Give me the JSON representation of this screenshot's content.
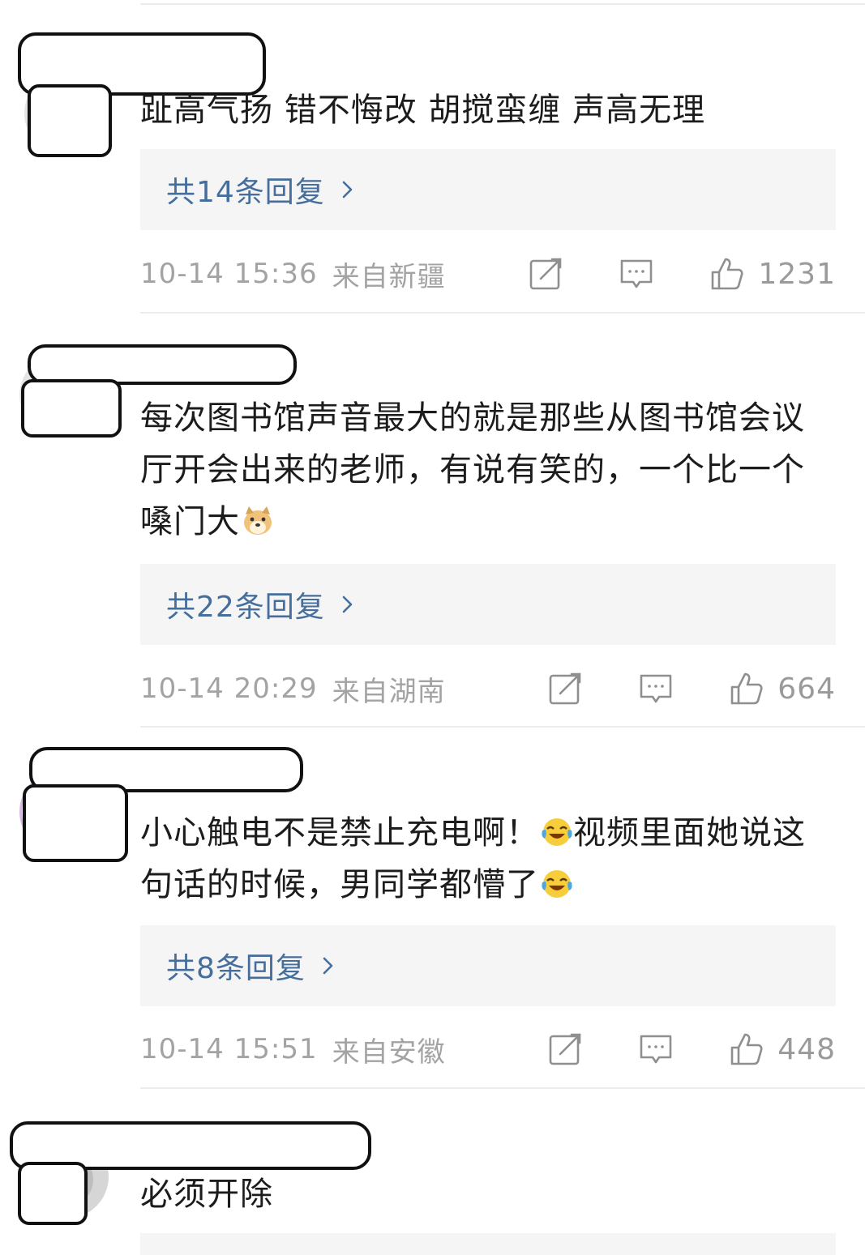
{
  "comments": [
    {
      "text": "趾高气扬 错不悔改 胡搅蛮缠 声高无理",
      "replies_label": "共14条回复",
      "timestamp": "10-14 15:36",
      "location": "来自新疆",
      "likes": "1231"
    },
    {
      "text": "每次图书馆声音最大的就是那些从图书馆会议厅开会出来的老师，有说有笑的，一个比一个嗓门大",
      "emoji_after": "doge-emoji",
      "replies_label": "共22条回复",
      "timestamp": "10-14 20:29",
      "location": "来自湖南",
      "likes": "664"
    },
    {
      "text_part1": "小心触电不是禁止充电啊！",
      "emoji_mid": "laugh-cry-emoji",
      "text_part2": "视频里面她说这句话的时候，男同学都懵了",
      "emoji_after": "laugh-cry-emoji",
      "replies_label": "共8条回复",
      "timestamp": "10-14 15:51",
      "location": "来自安徽",
      "likes": "448"
    },
    {
      "text": "必须开除"
    }
  ],
  "icons": {
    "share": "share-edit-icon",
    "comment": "comment-bubble-icon",
    "like": "thumbs-up-icon",
    "chevron": "chevron-right-icon"
  },
  "colors": {
    "reply_link": "#466e9c",
    "meta_text": "#a3a3a3",
    "reply_box_bg": "#f5f5f5"
  }
}
